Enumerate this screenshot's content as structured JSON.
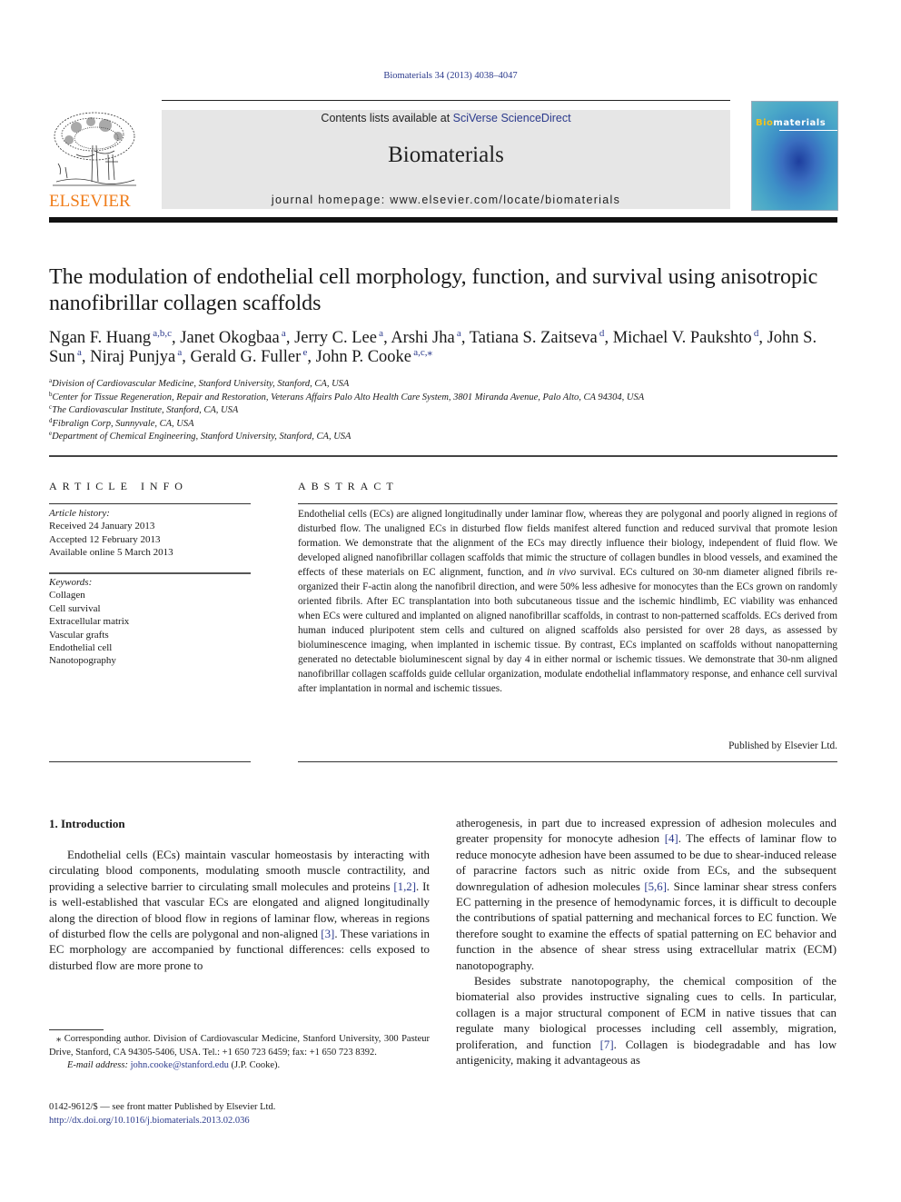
{
  "header": {
    "citation": "Biomaterials 34 (2013) 4038–4047",
    "contents_prefix": "Contents lists available at ",
    "contents_link": "SciVerse ScienceDirect",
    "journal_name": "Biomaterials",
    "homepage": "journal homepage: www.elsevier.com/locate/biomaterials",
    "publisher_logo_text": "ELSEVIER",
    "cover_title_highlight": "Bio",
    "cover_title_rest": "materials",
    "brand_orange": "#f07d1a",
    "link_color": "#2b3a8c"
  },
  "article": {
    "title": "The modulation of endothelial cell morphology, function, and survival using anisotropic nanofibrillar collagen scaffolds",
    "authors": [
      {
        "name": "Ngan F. Huang",
        "aff": "a,b,c"
      },
      {
        "name": "Janet Okogbaa",
        "aff": "a"
      },
      {
        "name": "Jerry C. Lee",
        "aff": "a"
      },
      {
        "name": "Arshi Jha",
        "aff": "a"
      },
      {
        "name": "Tatiana S. Zaitseva",
        "aff": "d"
      },
      {
        "name": "Michael V. Paukshto",
        "aff": "d"
      },
      {
        "name": "John S. Sun",
        "aff": "a"
      },
      {
        "name": "Niraj Punjya",
        "aff": "a"
      },
      {
        "name": "Gerald G. Fuller",
        "aff": "e"
      },
      {
        "name": "John P. Cooke",
        "aff": "a,c,⁎"
      }
    ],
    "affiliations": [
      {
        "key": "a",
        "text": "Division of Cardiovascular Medicine, Stanford University, Stanford, CA, USA"
      },
      {
        "key": "b",
        "text": "Center for Tissue Regeneration, Repair and Restoration, Veterans Affairs Palo Alto Health Care System, 3801 Miranda Avenue, Palo Alto, CA 94304, USA"
      },
      {
        "key": "c",
        "text": "The Cardiovascular Institute, Stanford, CA, USA"
      },
      {
        "key": "d",
        "text": "Fibralign Corp, Sunnyvale, CA, USA"
      },
      {
        "key": "e",
        "text": "Department of Chemical Engineering, Stanford University, Stanford, CA, USA"
      }
    ]
  },
  "article_info": {
    "heading": "ARTICLE INFO",
    "history_label": "Article history:",
    "received": "Received 24 January 2013",
    "accepted": "Accepted 12 February 2013",
    "online": "Available online 5 March 2013",
    "keywords_label": "Keywords:",
    "keywords": [
      "Collagen",
      "Cell survival",
      "Extracellular matrix",
      "Vascular grafts",
      "Endothelial cell",
      "Nanotopography"
    ]
  },
  "abstract": {
    "heading": "ABSTRACT",
    "text_part1": "Endothelial cells (ECs) are aligned longitudinally under laminar flow, whereas they are polygonal and poorly aligned in regions of disturbed flow. The unaligned ECs in disturbed flow fields manifest altered function and reduced survival that promote lesion formation. We demonstrate that the alignment of the ECs may directly influence their biology, independent of fluid flow. We developed aligned nanofibrillar collagen scaffolds that mimic the structure of collagen bundles in blood vessels, and examined the effects of these materials on EC alignment, function, and ",
    "text_italic": "in vivo",
    "text_part2": " survival. ECs cultured on 30-nm diameter aligned fibrils re-organized their F-actin along the nanofibril direction, and were 50% less adhesive for monocytes than the ECs grown on randomly oriented fibrils. After EC transplantation into both subcu­taneous tissue and the ischemic hindlimb, EC viability was enhanced when ECs were cultured and implanted on aligned nanofibrillar scaffolds, in contrast to non-patterned scaffolds. ECs derived from human induced pluripotent stem cells and cultured on aligned scaffolds also persisted for over 28 days, as assessed by bioluminescence imaging, when implanted in ischemic tissue. By contrast, ECs implanted on scaffolds without nanopatterning generated no detectable bioluminescent signal by day 4 in either normal or ischemic tissues. We demonstrate that 30-nm aligned nanofibrillar collagen scaffolds guide cellular organization, modulate endothelial inflammatory response, and enhance cell survival after im­plantation in normal and ischemic tissues.",
    "published_by": "Published by Elsevier Ltd."
  },
  "body": {
    "section_heading": "1.  Introduction",
    "left_p1_a": "Endothelial cells (ECs) maintain vascular homeostasis by inter­acting with circulating blood components, modulating smooth muscle contractility, and providing a selective barrier to circulating small molecules and proteins ",
    "left_p1_ref1": "[1,2]",
    "left_p1_b": ". It is well-established that vascular ECs are elongated and aligned longitudinally along the direction of blood flow in regions of laminar flow, whereas in re­gions of disturbed flow the cells are polygonal and non-aligned ",
    "left_p1_ref2": "[3]",
    "left_p1_c": ". These variations in EC morphology are accompanied by functional differences: cells exposed to disturbed flow are more prone to",
    "right_p1_a": "atherogenesis, in part due to increased expression of adhesion molecules and greater propensity for monocyte adhesion ",
    "right_p1_ref1": "[4]",
    "right_p1_b": ". The effects of laminar flow to reduce monocyte adhesion have been assumed to be due to shear-induced release of paracrine factors such as nitric oxide from ECs, and the subsequent downregulation of adhesion molecules ",
    "right_p1_ref2": "[5,6]",
    "right_p1_c": ". Since laminar shear stress confers EC patterning in the presence of hemodynamic forces, it is difficult to decouple the contributions of spatial patterning and mechanical forces to EC function. We therefore sought to examine the effects of spatial patterning on EC behavior and function in the absence of shear stress using extracellular matrix (ECM) nanotopography.",
    "right_p2_a": "Besides substrate nanotopography, the chemical composition of the biomaterial also provides instructive signaling cues to cells. In particular, collagen is a major structural component of ECM in native tissues that can regulate many biological processes including cell assembly, migration, proliferation, and function ",
    "right_p2_ref": "[7]",
    "right_p2_b": ". Collagen is biodegradable and has low antigenicity, making it advantageous as"
  },
  "footnote": {
    "corresponding": "⁎  Corresponding author. Division of Cardiovascular Medicine, Stanford University, 300 Pasteur Drive, Stanford, CA 94305-5406, USA. Tel.: +1 650 723 6459; fax: +1 650 723 8392.",
    "email_label": "E-mail address: ",
    "email": "john.cooke@stanford.edu",
    "email_suffix": " (J.P. Cooke).",
    "issn": "0142-9612/$ — see front matter Published by Elsevier Ltd.",
    "doi": "http://dx.doi.org/10.1016/j.biomaterials.2013.02.036"
  }
}
